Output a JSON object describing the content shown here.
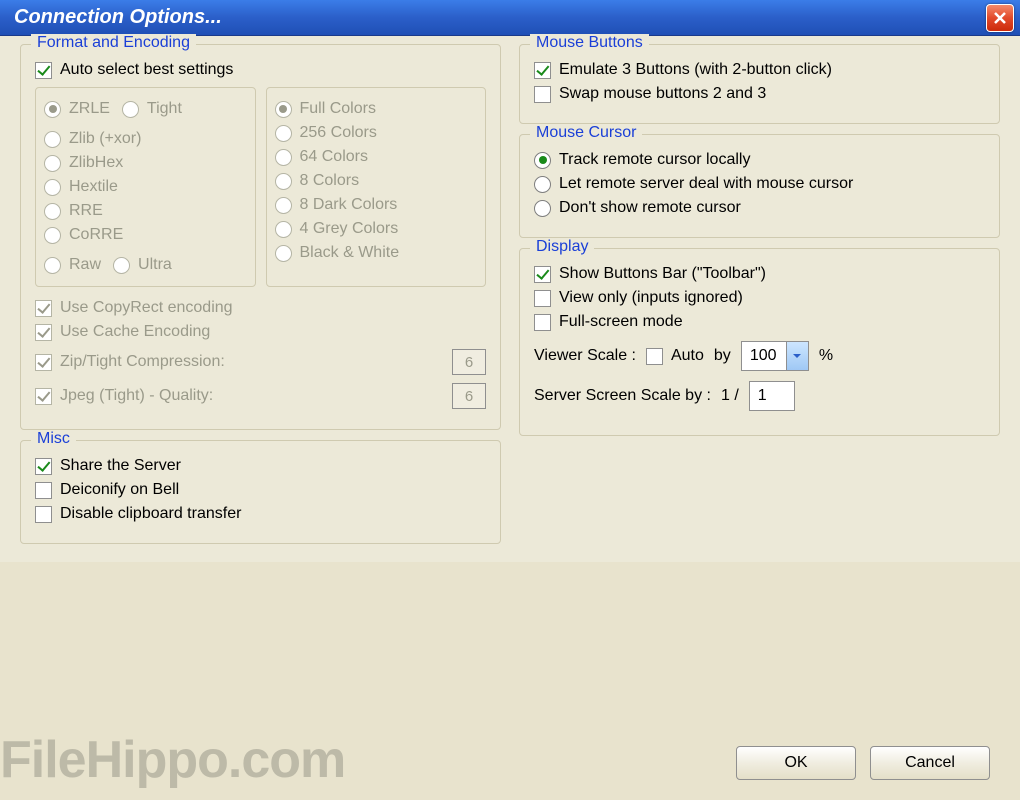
{
  "window": {
    "title": "Connection Options..."
  },
  "format_encoding": {
    "legend": "Format and Encoding",
    "auto_select": "Auto select best settings",
    "encodings": [
      "ZRLE",
      "Tight",
      "Zlib (+xor)",
      "ZlibHex",
      "Hextile",
      "RRE",
      "CoRRE",
      "Raw",
      "Ultra"
    ],
    "colors": [
      "Full Colors",
      "256 Colors",
      "64 Colors",
      "8 Colors",
      "8 Dark Colors",
      "4 Grey Colors",
      "Black & White"
    ],
    "copyrect": "Use CopyRect encoding",
    "cache": "Use Cache Encoding",
    "zip": "Zip/Tight Compression:",
    "zip_val": "6",
    "jpeg": "Jpeg (Tight) - Quality:",
    "jpeg_val": "6"
  },
  "misc": {
    "legend": "Misc",
    "share": "Share the Server",
    "deiconify": "Deiconify on Bell",
    "disable_clip": "Disable clipboard transfer"
  },
  "mouse_buttons": {
    "legend": "Mouse Buttons",
    "emulate": "Emulate 3 Buttons (with 2-button click)",
    "swap": "Swap mouse buttons 2 and 3"
  },
  "mouse_cursor": {
    "legend": "Mouse Cursor",
    "track": "Track remote cursor locally",
    "letremote": "Let remote server deal with mouse cursor",
    "dontshow": "Don't show remote cursor"
  },
  "display": {
    "legend": "Display",
    "toolbar": "Show Buttons Bar (\"Toolbar\")",
    "viewonly": "View only (inputs ignored)",
    "fullscreen": "Full-screen mode",
    "viewer_scale": "Viewer Scale :",
    "auto": "Auto",
    "by": "by",
    "scale_val": "100",
    "percent": "%",
    "server_scale": "Server Screen Scale by :",
    "one_over": "1  /",
    "server_val": "1"
  },
  "buttons": {
    "ok": "OK",
    "cancel": "Cancel"
  },
  "watermark": "FileHippo.com"
}
